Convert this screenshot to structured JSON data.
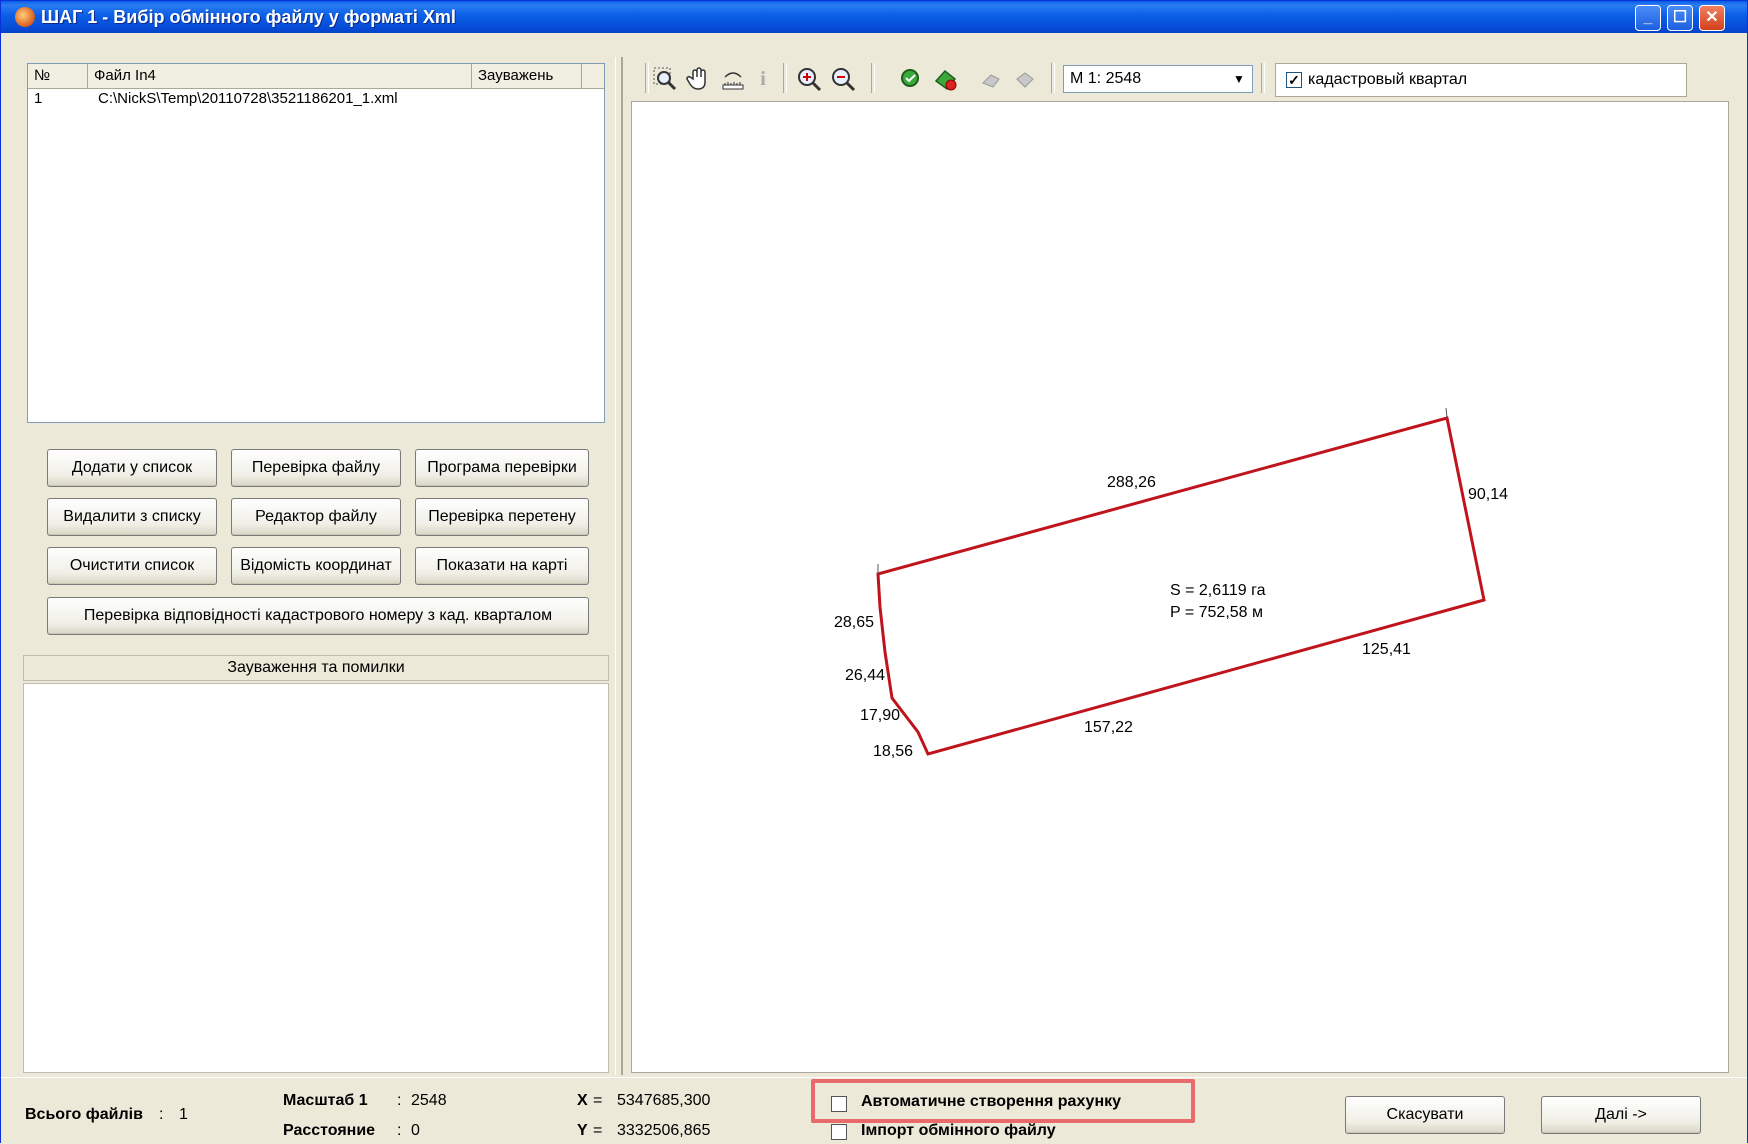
{
  "window": {
    "title": "ШАГ 1 - Вибір обмінного файлу у форматі Xml"
  },
  "file_list": {
    "columns": [
      "№",
      "Файл In4",
      "Зауважень"
    ],
    "rows": [
      {
        "num": "1",
        "path": "C:\\NickS\\Temp\\20110728\\3521186201_1.xml",
        "notes": ""
      }
    ]
  },
  "buttons": {
    "add": "Додати у список",
    "check_file": "Перевірка файлу",
    "check_program": "Програма перевірки",
    "remove": "Видалити з списку",
    "editor": "Редактор файлу",
    "check_overlap": "Перевірка перетену",
    "clear": "Очистити список",
    "coords": "Відомість координат",
    "show_map": "Показати на карті",
    "check_cadastral": "Перевірка відповідності кадастрового номеру з кад. кварталом"
  },
  "notes_header": "Зауваження та помилки",
  "toolbar": {
    "icons": [
      "zoom-window-icon",
      "pan-hand-icon",
      "measure-icon",
      "info-icon",
      "zoom-in-icon",
      "zoom-out-icon",
      "layer-add-icon",
      "layer-remove-icon",
      "undo-icon",
      "redo-icon"
    ],
    "scale_value": "М 1: 2548",
    "layer_label": "кадастровый квартал",
    "layer_checked": true
  },
  "map": {
    "area_text": "S = 2,6119 га",
    "perimeter_text": "P = 752,58 м",
    "edges": [
      "288,26",
      "90,14",
      "125,41",
      "157,22",
      "18,56",
      "17,90",
      "26,44",
      "28,65"
    ],
    "line_color": "#c0141c"
  },
  "status": {
    "total_label": "Всього файлів",
    "total_value": "1",
    "scale_label": "Масштаб  1",
    "scale_value": "2548",
    "distance_label": "Расстояние",
    "distance_value": "0",
    "x_label": "X",
    "x_value": "5347685,300",
    "y_label": "Y",
    "y_value": "3332506,865",
    "auto_invoice_label": "Автоматичне створення рахунку",
    "import_label": "Імпорт обмінного файлу",
    "cancel": "Скасувати",
    "next": "Далі ->"
  }
}
